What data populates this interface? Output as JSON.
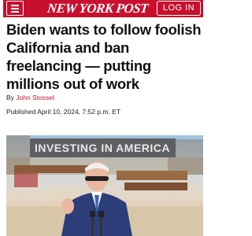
{
  "header": {
    "logo_text": "NEW YORK POST",
    "login_label": "LOG IN",
    "brand_color": "#c8102e"
  },
  "article": {
    "headline_lines": [
      "Biden wants to follow foolish",
      "California and ban",
      "freelancing — putting",
      "millions out of work"
    ],
    "byline_prefix": "By",
    "author": "John Stossel",
    "published": "Published April 10, 2024, 7:52 p.m. ET",
    "photo": {
      "banner_text": "INVESTING IN AMERICA"
    }
  }
}
